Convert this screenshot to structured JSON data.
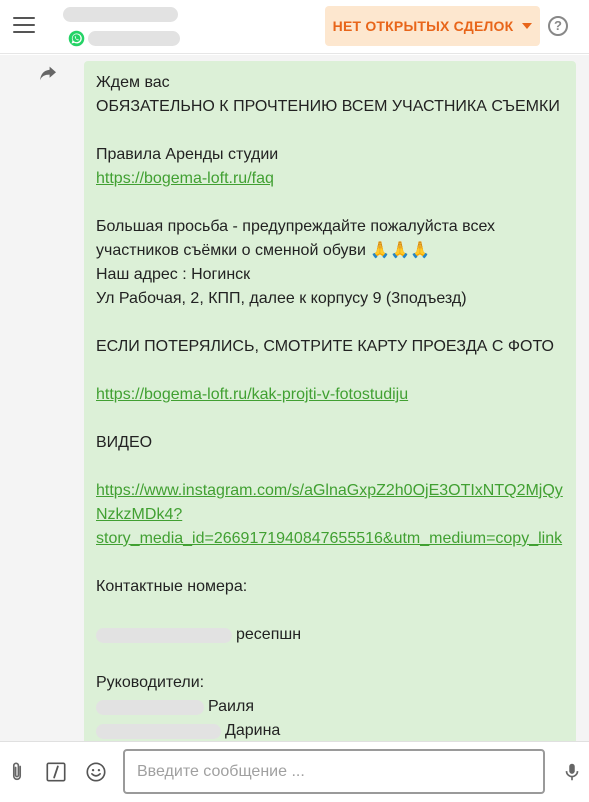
{
  "header": {
    "deals_label": "НЕТ ОТКРЫТЫХ СДЕЛОК",
    "help_label": "?"
  },
  "message": {
    "lines": [
      "Ждем вас",
      "ОБЯЗАТЕЛЬНО К ПРОЧТЕНИЮ ВСЕМ УЧАСТНИКА СЪЕМКИ",
      "",
      "Правила Аренды студии"
    ],
    "link_faq": "https://bogema-loft.ru/faq",
    "request": "Большая просьба - предупреждайте пожалуйста всех участников съёмки о сменной обуви 🙏🙏🙏",
    "address_label": "Наш адрес : Ногинск",
    "address_street": "Ул Рабочая, 2, КПП, далее к корпусу 9 (3подъезд)",
    "map_text": "ЕСЛИ ПОТЕРЯЛИСЬ, СМОТРИТЕ КАРТУ ПРОЕЗДА С ФОТО",
    "link_route": "https://bogema-loft.ru/kak-projti-v-fotostudiju",
    "video_label": "ВИДЕО",
    "link_video": "https://www.instagram.com/s/aGlnaGxpZ2h0OjE3OTIxNTQ2MjQyNzkzMDk4?story_media_id=2669171940847655516&utm_medium=copy_link",
    "link_video_line1": "https://www.instagram.com/s/aGlnaGxpZ2h0OjE3OTIxNTQ2MjQy",
    "link_video_line2": "NzkzMDk4?",
    "link_video_line3": "story_media_id=2669171940847655516&utm_medium=copy_link",
    "contacts_label": "Контактные номера:",
    "reception_label": "ресепшн",
    "managers_label": "Руководители:",
    "manager_1": "Раиля",
    "manager_2": "Дарина"
  },
  "composer": {
    "placeholder": "Введите сообщение ..."
  },
  "colors": {
    "accent": "#e8651a",
    "accent_bg": "#fde7cf",
    "bubble_bg": "#dcf0d7",
    "link": "#41a032",
    "whatsapp": "#25d366"
  },
  "icons": [
    "menu-icon",
    "whatsapp-icon",
    "chevron-down-icon",
    "help-icon",
    "forward-icon",
    "attach-icon",
    "slash-command-icon",
    "emoji-icon",
    "microphone-icon"
  ]
}
